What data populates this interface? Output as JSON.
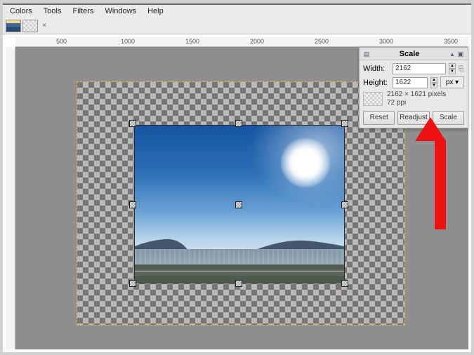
{
  "menu": {
    "colors": "Colors",
    "tools": "Tools",
    "filters": "Filters",
    "windows": "Windows",
    "help": "Help"
  },
  "ruler": {
    "t500": "500",
    "t1000": "1000",
    "t1500": "1500",
    "t2000": "2000",
    "t2500": "2500",
    "t3000": "3000",
    "t3500": "3500"
  },
  "dialog": {
    "title": "Scale",
    "width_label": "Width:",
    "height_label": "Height:",
    "width_value": "2162",
    "height_value": "1622",
    "unit": "px",
    "info_dims": "2162 × 1621 pixels",
    "info_ppi": "72 ppi",
    "buttons": {
      "reset": "Reset",
      "readjust": "Readjust",
      "scale": "Scale"
    }
  }
}
